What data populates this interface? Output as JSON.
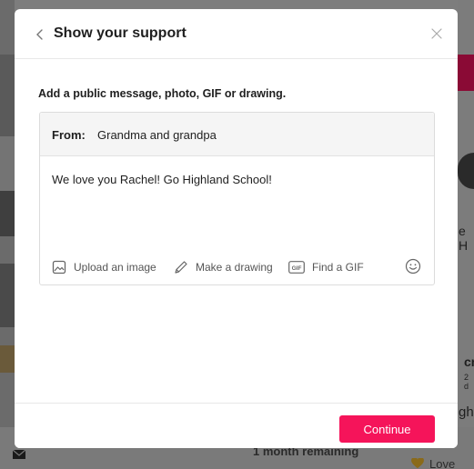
{
  "background": {
    "footer_text": "1 month remaining",
    "love_label": "Love",
    "fragments": [
      "e H",
      "cr",
      "2 d",
      "ghl"
    ],
    "mail_icon": "mail-icon",
    "heart_icon": "heart-icon"
  },
  "modal": {
    "title": "Show your support",
    "back_icon": "chevron-left-icon",
    "close_icon": "close-icon",
    "instruction": "Add a public message, photo, GIF or drawing.",
    "from_label": "From:",
    "from_value": "Grandma and grandpa",
    "message": "We love you Rachel! Go Highland School!",
    "tools": {
      "upload": {
        "label": "Upload an image",
        "icon": "image-icon"
      },
      "draw": {
        "label": "Make a drawing",
        "icon": "pencil-icon"
      },
      "gif": {
        "label": "Find a GIF",
        "icon": "gif-icon",
        "badge": "GIF"
      },
      "emoji_icon": "smiley-icon"
    },
    "continue_label": "Continue"
  },
  "colors": {
    "accent": "#f5145a",
    "overlay": "#7d7d7d",
    "text": "#1f1f1f",
    "muted": "#555555"
  }
}
